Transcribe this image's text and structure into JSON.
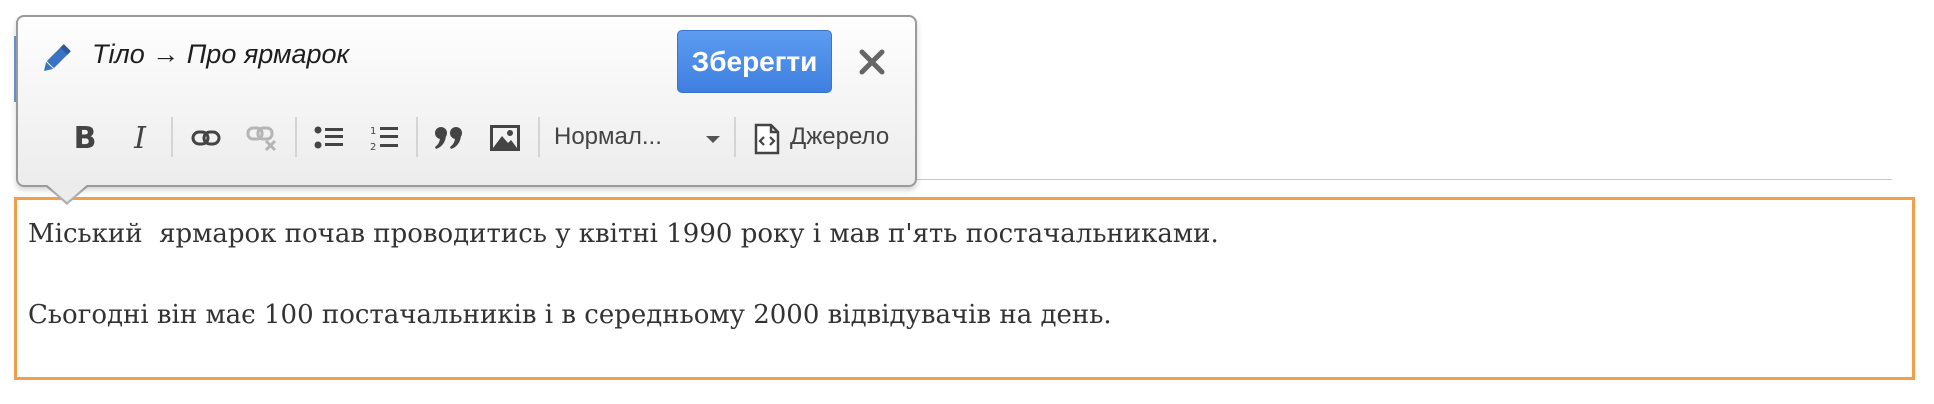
{
  "toolbar": {
    "title": "Тіло → Про ярмарок",
    "save_label": "Зберегти",
    "format_value": "Нормал...",
    "source_label": "Джерело",
    "accent_color": "#4a8be8",
    "buttons": [
      {
        "name": "bold",
        "glyph": "B"
      },
      {
        "name": "italic",
        "glyph": "I"
      },
      {
        "name": "link",
        "icon": "link-icon"
      },
      {
        "name": "unlink",
        "icon": "unlink-icon"
      },
      {
        "name": "bulleted-list",
        "icon": "bulleted-list-icon"
      },
      {
        "name": "numbered-list",
        "icon": "numbered-list-icon"
      },
      {
        "name": "blockquote",
        "icon": "blockquote-icon"
      },
      {
        "name": "image",
        "icon": "image-icon"
      }
    ]
  },
  "editor": {
    "border_color": "#f0a04a",
    "paragraphs": [
      "Міський  ярмарок почав проводитись у квітні 1990 року і мав п'ять постачальниками.",
      "Сьогодні він має 100 постачальників і в середньому 2000 відвідувачів на день."
    ]
  }
}
